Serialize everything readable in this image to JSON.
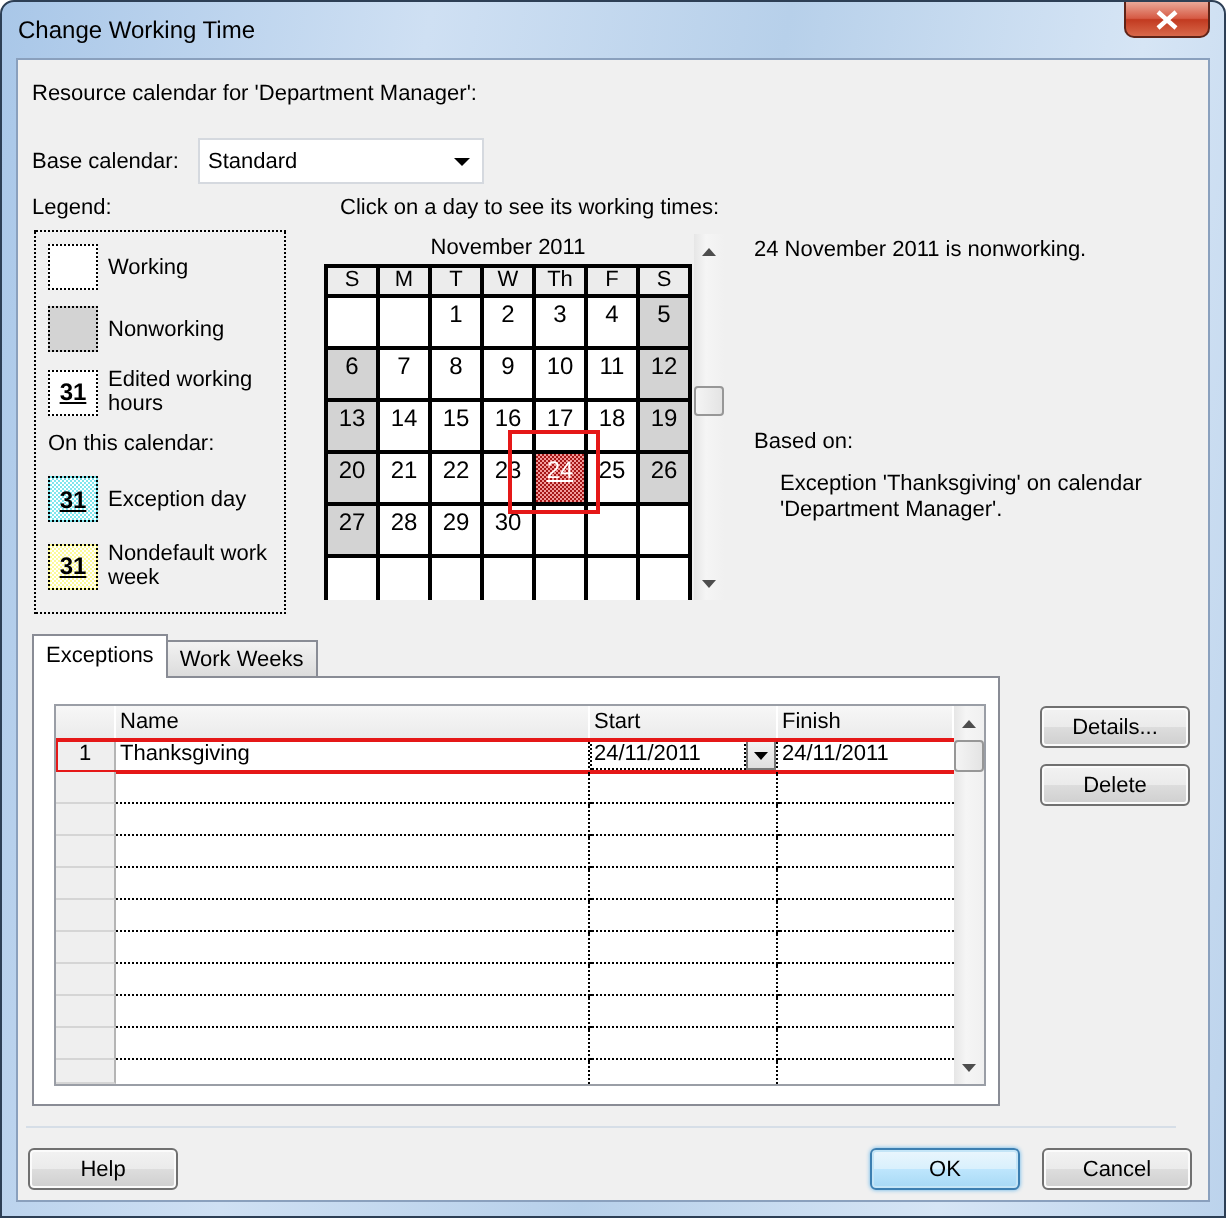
{
  "window": {
    "title": "Change Working Time"
  },
  "resource_label": "Resource calendar for 'Department Manager':",
  "base_calendar": {
    "label": "Base calendar:",
    "value": "Standard"
  },
  "legend": {
    "title": "Legend:",
    "items": [
      {
        "kind": "working",
        "label": "Working"
      },
      {
        "kind": "nonworking",
        "label": "Nonworking"
      },
      {
        "kind": "edited",
        "label": "Edited working hours",
        "sample": "31"
      }
    ],
    "section_title": "On this calendar:",
    "calendar_items": [
      {
        "kind": "exception",
        "label": "Exception day",
        "sample": "31"
      },
      {
        "kind": "nondefault",
        "label": "Nondefault work week",
        "sample": "31"
      }
    ]
  },
  "calendar": {
    "instruction": "Click on a day to see its working times:",
    "month": "November 2011",
    "weekdays": [
      "S",
      "M",
      "T",
      "W",
      "Th",
      "F",
      "S"
    ],
    "weeks": [
      [
        {
          "kind": "blank",
          "selected": false,
          "highlighted": false
        },
        {
          "kind": "blank",
          "selected": false,
          "highlighted": false
        },
        {
          "label": "1",
          "kind": "working",
          "selected": false,
          "highlighted": false
        },
        {
          "label": "2",
          "kind": "working",
          "selected": false,
          "highlighted": false
        },
        {
          "label": "3",
          "kind": "working",
          "selected": false,
          "highlighted": false
        },
        {
          "label": "4",
          "kind": "working",
          "selected": false,
          "highlighted": false
        },
        {
          "label": "5",
          "kind": "nonworking",
          "selected": false,
          "highlighted": false
        }
      ],
      [
        {
          "label": "6",
          "kind": "nonworking",
          "selected": false,
          "highlighted": false
        },
        {
          "label": "7",
          "kind": "working",
          "selected": false,
          "highlighted": false
        },
        {
          "label": "8",
          "kind": "working",
          "selected": false,
          "highlighted": false
        },
        {
          "label": "9",
          "kind": "working",
          "selected": false,
          "highlighted": false
        },
        {
          "label": "10",
          "kind": "working",
          "selected": false,
          "highlighted": false
        },
        {
          "label": "11",
          "kind": "working",
          "selected": false,
          "highlighted": false
        },
        {
          "label": "12",
          "kind": "nonworking",
          "selected": false,
          "highlighted": false
        }
      ],
      [
        {
          "label": "13",
          "kind": "nonworking",
          "selected": false,
          "highlighted": false
        },
        {
          "label": "14",
          "kind": "working",
          "selected": false,
          "highlighted": false
        },
        {
          "label": "15",
          "kind": "working",
          "selected": false,
          "highlighted": false
        },
        {
          "label": "16",
          "kind": "working",
          "selected": false,
          "highlighted": false
        },
        {
          "label": "17",
          "kind": "working",
          "selected": false,
          "highlighted": false
        },
        {
          "label": "18",
          "kind": "working",
          "selected": false,
          "highlighted": false
        },
        {
          "label": "19",
          "kind": "nonworking",
          "selected": false,
          "highlighted": false
        }
      ],
      [
        {
          "label": "20",
          "kind": "nonworking",
          "selected": false,
          "highlighted": false
        },
        {
          "label": "21",
          "kind": "working",
          "selected": false,
          "highlighted": false
        },
        {
          "label": "22",
          "kind": "working",
          "selected": false,
          "highlighted": false
        },
        {
          "label": "23",
          "kind": "working",
          "selected": false,
          "highlighted": false
        },
        {
          "label": "24",
          "kind": "exception",
          "selected": true,
          "highlighted": true
        },
        {
          "label": "25",
          "kind": "working",
          "selected": false,
          "highlighted": false
        },
        {
          "label": "26",
          "kind": "nonworking",
          "selected": false,
          "highlighted": false
        }
      ],
      [
        {
          "label": "27",
          "kind": "nonworking",
          "selected": false,
          "highlighted": false
        },
        {
          "label": "28",
          "kind": "working",
          "selected": false,
          "highlighted": false
        },
        {
          "label": "29",
          "kind": "working",
          "selected": false,
          "highlighted": false
        },
        {
          "label": "30",
          "kind": "working",
          "selected": false,
          "highlighted": false
        },
        {
          "kind": "blank",
          "selected": false,
          "highlighted": false
        },
        {
          "kind": "blank",
          "selected": false,
          "highlighted": false
        },
        {
          "kind": "blank",
          "selected": false,
          "highlighted": false
        }
      ],
      [
        {
          "kind": "blank",
          "selected": false,
          "highlighted": false
        },
        {
          "kind": "blank",
          "selected": false,
          "highlighted": false
        },
        {
          "kind": "blank",
          "selected": false,
          "highlighted": false
        },
        {
          "kind": "blank",
          "selected": false,
          "highlighted": false
        },
        {
          "kind": "blank",
          "selected": false,
          "highlighted": false
        },
        {
          "kind": "blank",
          "selected": false,
          "highlighted": false
        },
        {
          "kind": "blank",
          "selected": false,
          "highlighted": false
        }
      ]
    ]
  },
  "day_info": {
    "status": "24 November 2011 is nonworking.",
    "based_on_label": "Based on:",
    "based_on_text": "Exception 'Thanksgiving' on calendar 'Department Manager'."
  },
  "tabs": [
    {
      "label": "Exceptions",
      "selected": true
    },
    {
      "label": "Work Weeks",
      "selected": false
    }
  ],
  "exceptions_table": {
    "columns": [
      {
        "label": "Name"
      },
      {
        "label": "Start"
      },
      {
        "label": "Finish"
      }
    ],
    "rows": [
      {
        "number": "1",
        "highlighted": true,
        "cells": [
          {
            "text": "Thanksgiving",
            "active": false
          },
          {
            "text": "24/11/2011",
            "active": true
          },
          {
            "text": "24/11/2011",
            "active": false
          }
        ]
      }
    ]
  },
  "side_buttons": [
    {
      "label": "Details..."
    },
    {
      "label": "Delete"
    }
  ],
  "footer": {
    "help": "Help",
    "buttons": [
      {
        "label": "OK",
        "default": true
      },
      {
        "label": "Cancel",
        "default": false
      }
    ]
  }
}
